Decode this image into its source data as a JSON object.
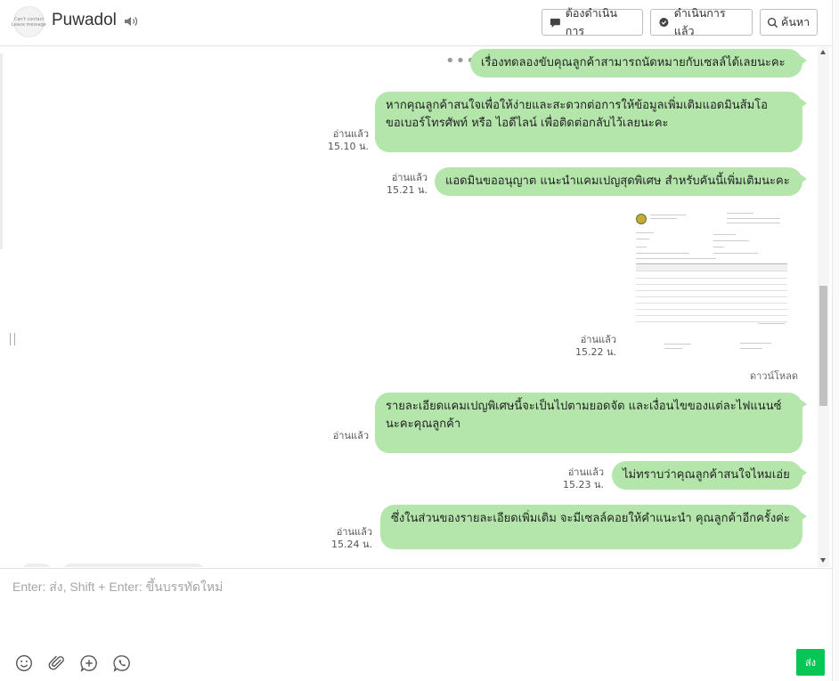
{
  "header": {
    "avatar_line1": "Can't contact",
    "avatar_line2": "Leave message",
    "contact_name": "Puwadol",
    "sound_icon": "speaker-icon",
    "btn_pending": "ต้องดำเนินการ",
    "btn_done": "ดำเนินการแล้ว",
    "btn_search": "ค้นหา"
  },
  "messages": [
    {
      "text": "เรื่องทดลองขับคุณลูกค้าสามารถนัดหมายกับเซลล์ได้เลยนะคะ",
      "status": "",
      "time": ""
    },
    {
      "text_line1": "หากคุณลูกค้าสนใจเพื่อให้ง่ายและสะดวกต่อการให้ข้อมูลเพิ่มเติมแอดมินส้มโอ",
      "text_line2": "ขอเบอร์โทรศัพท์ หรือ ไอดีไลน์ เพื่อติดต่อกลับไว้เลยนะคะ",
      "status": "อ่านแล้ว",
      "time": "15.10 น."
    },
    {
      "text": "แอดมินขออนุญาต แนะนำแคมเปญสุดพิเศษ สำหรับคันนี้เพิ่มเติมนะคะ",
      "status": "อ่านแล้ว",
      "time": "15.21 น."
    },
    {
      "type": "image",
      "status": "อ่านแล้ว",
      "time": "15.22 น.",
      "download": "ดาวน์โหลด"
    },
    {
      "text_line1": "รายละเอียดแคมเปญพิเศษนี้จะเป็นไปตามยอดจัด และเงื่อนไขของแต่ละไฟแนนซ์",
      "text_line2": "นะคะคุณลูกค้า",
      "status": "อ่านแล้ว",
      "time": ""
    },
    {
      "text": "ไม่ทราบว่าคุณลูกค้าสนใจไหมเอ่ย",
      "status": "อ่านแล้ว",
      "time": "15.23 น."
    },
    {
      "text": "ซึ่งในส่วนของรายละเอียดเพิ่มเติม จะมีเซลล์คอยให้คำแนะนำ คุณลูกค้าอีกครั้งค่ะ",
      "status": "อ่านแล้ว",
      "time": "15.24 น."
    }
  ],
  "composer": {
    "placeholder": "Enter: ส่ง, Shift + Enter: ขึ้นบรรทัดใหม่",
    "value": "",
    "tools": [
      "emoji-icon",
      "attachment-icon",
      "add-icon",
      "phone-icon"
    ],
    "send_label": "ส่ง"
  },
  "colors": {
    "bubble": "#b4e6ab",
    "send_button": "#06c755",
    "header_border": "#bdbdbd"
  }
}
